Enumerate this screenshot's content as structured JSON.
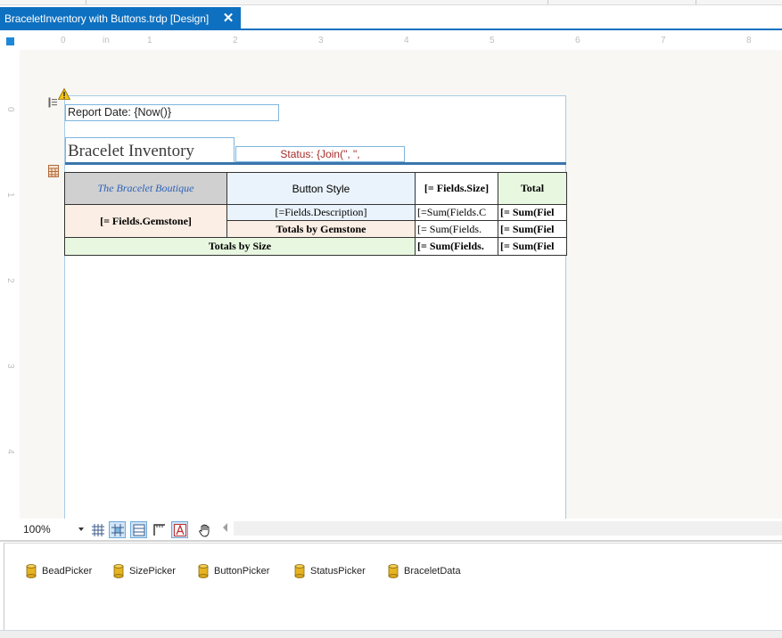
{
  "tab": {
    "title": "BraceletInventory with Buttons.trdp [Design]",
    "close_glyph": "✕"
  },
  "ruler": {
    "unit": "in",
    "h_labels": [
      "0",
      "1",
      "2",
      "3",
      "4",
      "5",
      "6",
      "7",
      "8"
    ],
    "v_labels": [
      "0",
      "1",
      "2",
      "3",
      "4"
    ]
  },
  "report": {
    "date_text": "Report Date: {Now()}",
    "title": "Bracelet Inventory",
    "status_text": "Status: {Join(\", \","
  },
  "table": {
    "corner": "The Bracelet Boutique",
    "col_header": "Button Style",
    "size_header": "[= Fields.Size]",
    "total_header": "Total",
    "gemstone": "[= Fields.Gemstone]",
    "description": "[=Fields.Description]",
    "sum_cell": "[=Sum(Fields.C",
    "sum_total_cell": "[= Sum(Fiel",
    "totals_by_gemstone": "Totals by Gemstone",
    "gem_total_cell": "[= Sum(Fields.",
    "gem_grand_cell": "[= Sum(Fiel",
    "totals_by_size": "Totals by Size",
    "size_total_cell": "[= Sum(Fields.",
    "grand_total_cell": "[= Sum(Fiel"
  },
  "toolbar": {
    "zoom": "100%"
  },
  "data_sources": [
    "BeadPicker",
    "SizePicker",
    "ButtonPicker",
    "StatusPicker",
    "BraceletData"
  ],
  "colors": {
    "accent": "#0e70c0",
    "status_text": "#a52a2a",
    "corner_text": "#2e62b8"
  },
  "icons": [
    "warning-icon",
    "section-icon",
    "table-section-icon",
    "grid-icon",
    "snap-icon",
    "table-icon",
    "ruler-icon",
    "text-icon",
    "hand-pan-icon",
    "database-icon"
  ]
}
